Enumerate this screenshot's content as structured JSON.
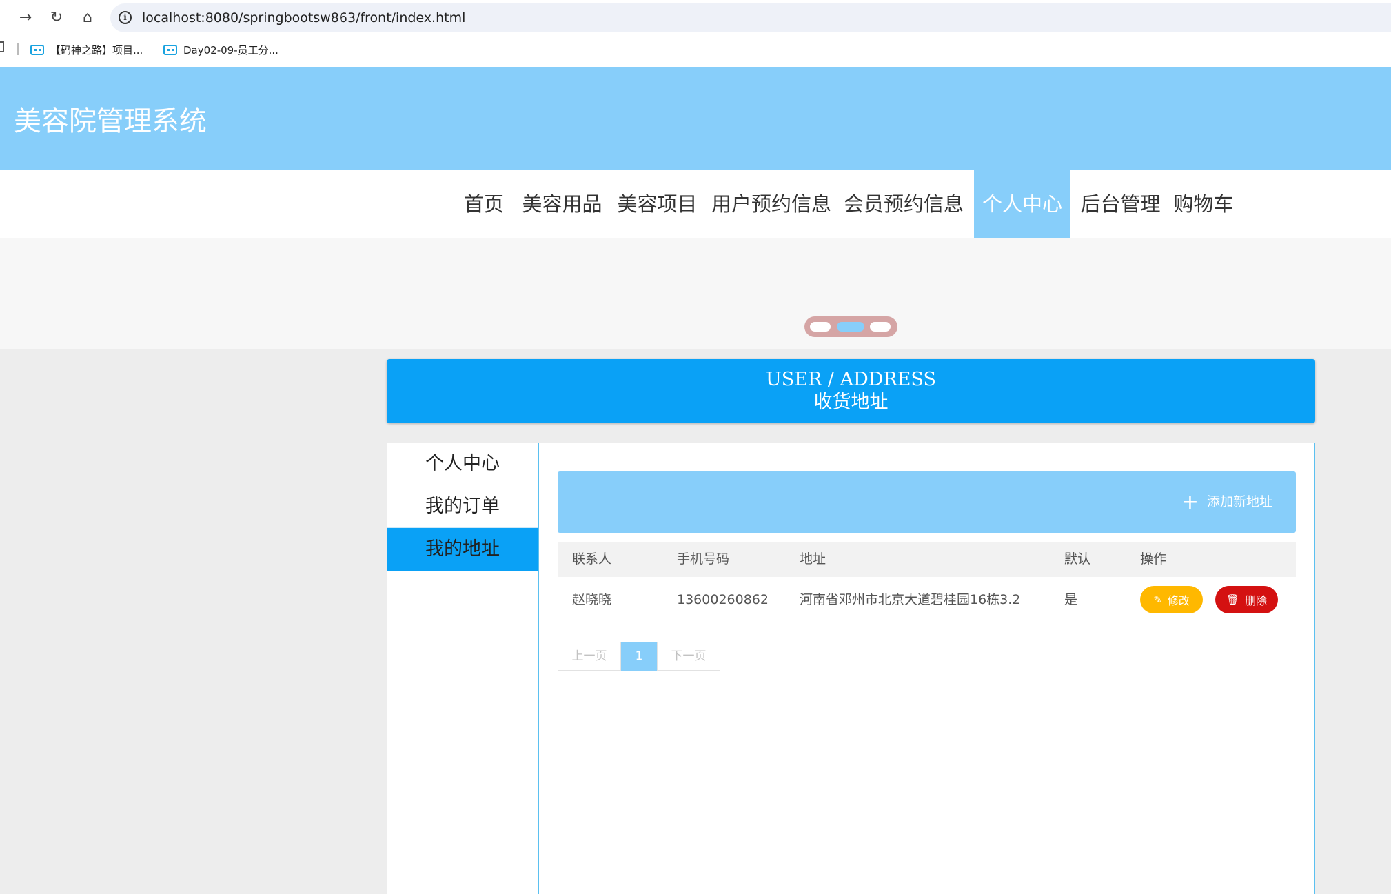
{
  "browser": {
    "url": "localhost:8080/springbootsw863/front/index.html",
    "bookmarks": [
      "【码神之路】项目...",
      "Day02-09-员工分..."
    ]
  },
  "site": {
    "title": "美容院管理系统",
    "nav": [
      "首页",
      "美容用品",
      "美容项目",
      "用户预约信息",
      "会员预约信息",
      "个人中心",
      "后台管理",
      "购物车"
    ],
    "active_nav": "个人中心",
    "accent_color": "#87cefa"
  },
  "page_head": {
    "en": "USER / ADDRESS",
    "zh": "收货地址"
  },
  "side_menu": [
    "个人中心",
    "我的订单",
    "我的地址"
  ],
  "address": {
    "add_label": "添加新地址",
    "columns": [
      "联系人",
      "手机号码",
      "地址",
      "默认",
      "操作"
    ],
    "rows": [
      {
        "name": "赵晓晓",
        "phone": "13600260862",
        "address": "河南省邓州市北京大道碧桂园16栋3.2",
        "default": "是"
      }
    ],
    "edit_label": "修改",
    "delete_label": "删除"
  },
  "pager": {
    "prev": "上一页",
    "current": "1",
    "next": "下一页"
  }
}
